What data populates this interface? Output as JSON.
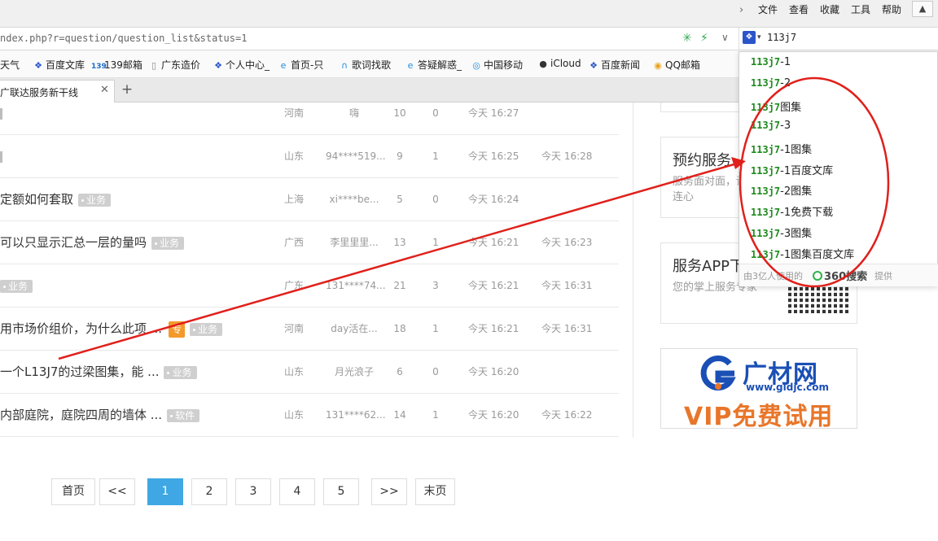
{
  "menu": {
    "items": [
      "文件",
      "查看",
      "收藏",
      "工具",
      "帮助"
    ]
  },
  "address": {
    "url": "ndex.php?r=question/question_list&status=1",
    "search_query": "113j7"
  },
  "bookmarks": [
    "天气",
    "百度文库",
    "139邮箱",
    "广东造价",
    "个人中心_",
    "首页-只",
    "歌词找歌",
    "答疑解惑_",
    "中国移动",
    "iCloud",
    "百度新闻",
    "QQ邮箱"
  ],
  "tab": {
    "title": "广联达服务新干线"
  },
  "rows": [
    {
      "title": "",
      "tag": "",
      "province": "河南",
      "user": "嗨",
      "views": "10",
      "answers": "0",
      "time": "今天 16:27",
      "last": ""
    },
    {
      "title": "",
      "tag": "",
      "province": "山东",
      "user": "94****519...",
      "views": "9",
      "answers": "1",
      "time": "今天 16:25",
      "last": "今天 16:28"
    },
    {
      "title": "定额如何套取",
      "tag": "业务",
      "province": "上海",
      "user": "xi****be...",
      "views": "5",
      "answers": "0",
      "time": "今天 16:24",
      "last": ""
    },
    {
      "title": "可以只显示汇总一层的量吗",
      "tag": "业务",
      "province": "广西",
      "user": "李里里里...",
      "views": "13",
      "answers": "1",
      "time": "今天 16:21",
      "last": "今天 16:23"
    },
    {
      "title": "",
      "tag": "业务",
      "province": "广东",
      "user": "131****74...",
      "views": "21",
      "answers": "3",
      "time": "今天 16:21",
      "last": "今天 16:31"
    },
    {
      "title": "用市场价组价，为什么此项 ...",
      "tag": "业务",
      "zhuan": "专",
      "province": "河南",
      "user": "day活在...",
      "views": "18",
      "answers": "1",
      "time": "今天 16:21",
      "last": "今天 16:31"
    },
    {
      "title": "一个L13J7的过梁图集，能 ...",
      "tag": "业务",
      "province": "山东",
      "user": "月光浪子",
      "views": "6",
      "answers": "0",
      "time": "今天 16:20",
      "last": ""
    },
    {
      "title": "内部庭院，庭院四周的墙体 ...",
      "tag": "软件",
      "province": "山东",
      "user": "131****62...",
      "views": "14",
      "answers": "1",
      "time": "今天 16:20",
      "last": "今天 16:22"
    }
  ],
  "widgets": {
    "booking": {
      "title": "预约服务",
      "desc": "服务面对面，诺心连心"
    },
    "app": {
      "title": "服务APP下",
      "desc": "您的掌上服务专家"
    },
    "ad": {
      "name": "广材网",
      "url": "www.gldjc.com",
      "vip": "VIP免费试用"
    }
  },
  "pagination": [
    "首页",
    "<<",
    "1",
    "2",
    "3",
    "4",
    "5",
    ">>",
    "末页"
  ],
  "suggestions": {
    "items": [
      {
        "hl": "113j7",
        "rest": "-1"
      },
      {
        "hl": "113j7",
        "rest": "-2"
      },
      {
        "hl": "113j7",
        "rest": "图集"
      },
      {
        "hl": "113j7",
        "rest": "-3"
      },
      {
        "hl": "113j7",
        "rest": "-1图集"
      },
      {
        "hl": "113j7",
        "rest": "-1百度文库"
      },
      {
        "hl": "113j7",
        "rest": "-2图集"
      },
      {
        "hl": "113j7",
        "rest": "-1免费下载"
      },
      {
        "hl": "113j7",
        "rest": "-3图集"
      },
      {
        "hl": "113j7",
        "rest": "-1图集百度文库"
      }
    ],
    "footer_prefix": "由3亿人使用的",
    "footer_brand": "360搜索",
    "footer_suffix": "提供"
  },
  "colors": {
    "accent": "#3fa7e4",
    "annotation": "#e0201b",
    "suggest_highlight": "#1e8a1e"
  }
}
